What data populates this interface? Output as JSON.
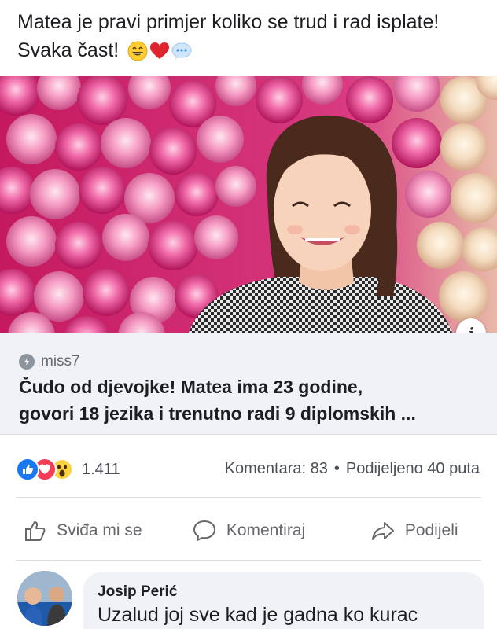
{
  "post": {
    "text": "Matea je pravi primjer koliko se trud i rad isplate! Svaka čast!",
    "emojis": [
      "grinning-face-icon",
      "red-heart-icon",
      "speech-bubble-icon"
    ]
  },
  "link_preview": {
    "source": "miss7",
    "title_line1": "Čudo od djevojke! Matea ima 23 godine,",
    "title_line2": "govori 18 jezika i trenutno radi 9 diplomskih ...",
    "info_label": "i"
  },
  "stats": {
    "reaction_icons": [
      "like-icon",
      "love-icon",
      "wow-icon"
    ],
    "reaction_count": "1.411",
    "comments_text": "Komentara: 83",
    "separator": "•",
    "shares_text": "Podijeljeno 40 puta"
  },
  "actions": {
    "like_label": "Sviđa mi se",
    "comment_label": "Komentiraj",
    "share_label": "Podijeli"
  },
  "comment": {
    "author": "Josip Perić",
    "text": "Uzalud joj sve kad je gadna ko kurac"
  },
  "colors": {
    "facebook_blue": "#1877f2",
    "love_red": "#f33e58",
    "link_box_bg": "#f0f2f5",
    "muted_text": "#65676b"
  }
}
